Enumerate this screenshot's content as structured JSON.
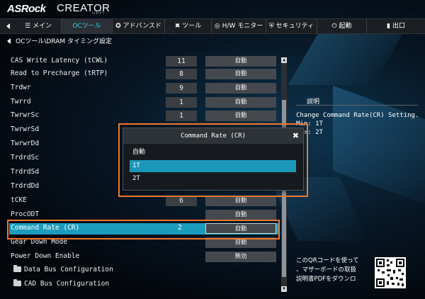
{
  "header": {
    "logo": "ASRock",
    "product": "CREATOR",
    "uefi": "UEFI"
  },
  "tabs": [
    {
      "label": "メイン",
      "icon": "list-icon"
    },
    {
      "label": "OCツール",
      "icon": "",
      "active": true
    },
    {
      "label": "アドバンスド",
      "icon": "star-icon"
    },
    {
      "label": "ツール",
      "icon": "tools-icon"
    },
    {
      "label": "H/W モニター",
      "icon": "monitor-icon"
    },
    {
      "label": "セキュリティ",
      "icon": "shield-icon"
    },
    {
      "label": "起動",
      "icon": "power-icon"
    },
    {
      "label": "出口",
      "icon": "exit-icon"
    }
  ],
  "breadcrumb": "OCツール\\DRAM タイミング設定",
  "settings": [
    {
      "label": "CAS Write Latency (tCWL)",
      "value": "11",
      "option": "自動"
    },
    {
      "label": "Read to Precharge (tRTP)",
      "value": "8",
      "option": "自動"
    },
    {
      "label": "Trdwr",
      "value": "9",
      "option": "自動"
    },
    {
      "label": "Twrrd",
      "value": "1",
      "option": "自動"
    },
    {
      "label": "TwrwrSc",
      "value": "1",
      "option": "自動"
    },
    {
      "label": "TwrwrSd",
      "value": "",
      "option": ""
    },
    {
      "label": "TwrwrDd",
      "value": "",
      "option": ""
    },
    {
      "label": "TrdrdSc",
      "value": "",
      "option": ""
    },
    {
      "label": "TrdrdSd",
      "value": "",
      "option": ""
    },
    {
      "label": "TrdrdDd",
      "value": "",
      "option": ""
    },
    {
      "label": "tCKE",
      "value": "6",
      "option": "自動"
    },
    {
      "label": "ProcODT",
      "value": "",
      "option": "自動"
    },
    {
      "label": "Command Rate (CR)",
      "value": "2",
      "option": "自動",
      "selected": true
    },
    {
      "label": "Gear Down Mode",
      "value": "",
      "option": "自動"
    },
    {
      "label": "Power Down Enable",
      "value": "",
      "option": "無効"
    },
    {
      "label": "Data Bus Configuration",
      "value": "",
      "option": "",
      "folder": true
    },
    {
      "label": "CAD Bus Configuration",
      "value": "",
      "option": "",
      "folder": true
    }
  ],
  "description": {
    "title": "説明",
    "text": "Change Command Rate(CR) Setting.\nMin: 1T\nMax: 2T"
  },
  "qr": {
    "line1": "このQRコードを使って",
    "line2": "、マザーボードの取扱",
    "line3": "説明書PDFをダウンロ"
  },
  "popup": {
    "title": "Command Rate (CR)",
    "close": "✖",
    "options": [
      "自動",
      "1T",
      "2T"
    ],
    "highlighted_index": 1
  },
  "colors": {
    "accent": "#1c9cbd",
    "highlight_box": "#f1772b",
    "active_tab_text": "#4fc3e8"
  }
}
